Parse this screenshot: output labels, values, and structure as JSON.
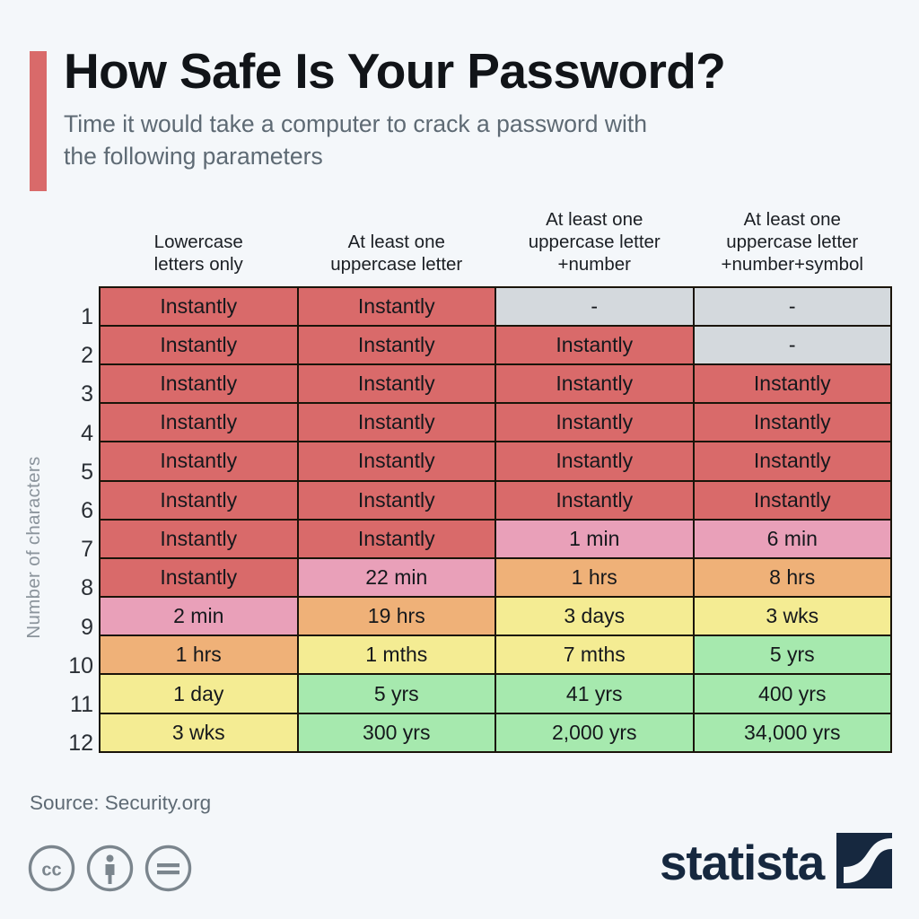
{
  "header": {
    "title": "How Safe Is Your Password?",
    "subtitle": "Time it would take a computer to crack a password with the following parameters",
    "accent_color": "#d96a6a"
  },
  "axis": {
    "y_title": "Number of characters"
  },
  "footer": {
    "source": "Source: Security.org",
    "brand": "statista",
    "cc_icons": [
      "creative-commons-icon",
      "attribution-icon",
      "no-derivatives-icon"
    ]
  },
  "legend_colors": {
    "instant_red": "#d96a6a",
    "minutes_pink": "#e9a0b9",
    "hours_orange": "#efb178",
    "days_months_yellow": "#f4ec93",
    "years_green": "#a6e9ae",
    "not_applicable_gray": "#d4d9dd"
  },
  "chart_data": {
    "type": "heatmap",
    "title": "How Safe Is Your Password?",
    "subtitle": "Time it would take a computer to crack a password with the following parameters",
    "xlabel": "",
    "ylabel": "Number of characters",
    "source": "Source: Security.org",
    "grid": true,
    "legend": "none",
    "categories": [
      "Lowercase letters only",
      "At least one uppercase letter",
      "At least one uppercase letter +number",
      "At least one uppercase letter +number+symbol"
    ],
    "column_headers": [
      [
        "Lowercase",
        "letters only"
      ],
      [
        "At least one",
        "uppercase letter"
      ],
      [
        "At least one",
        "uppercase letter",
        "+number"
      ],
      [
        "At least one",
        "uppercase letter",
        "+number+symbol"
      ]
    ],
    "row_labels": [
      "1",
      "2",
      "3",
      "4",
      "5",
      "6",
      "7",
      "8",
      "9",
      "10",
      "11",
      "12"
    ],
    "rows": [
      {
        "n": "1",
        "cells": [
          {
            "text": "Instantly",
            "color": "#d96a6a",
            "level": "instant"
          },
          {
            "text": "Instantly",
            "color": "#d96a6a",
            "level": "instant"
          },
          {
            "text": "-",
            "color": "#d4d9dd",
            "level": "na"
          },
          {
            "text": "-",
            "color": "#d4d9dd",
            "level": "na"
          }
        ]
      },
      {
        "n": "2",
        "cells": [
          {
            "text": "Instantly",
            "color": "#d96a6a",
            "level": "instant"
          },
          {
            "text": "Instantly",
            "color": "#d96a6a",
            "level": "instant"
          },
          {
            "text": "Instantly",
            "color": "#d96a6a",
            "level": "instant"
          },
          {
            "text": "-",
            "color": "#d4d9dd",
            "level": "na"
          }
        ]
      },
      {
        "n": "3",
        "cells": [
          {
            "text": "Instantly",
            "color": "#d96a6a",
            "level": "instant"
          },
          {
            "text": "Instantly",
            "color": "#d96a6a",
            "level": "instant"
          },
          {
            "text": "Instantly",
            "color": "#d96a6a",
            "level": "instant"
          },
          {
            "text": "Instantly",
            "color": "#d96a6a",
            "level": "instant"
          }
        ]
      },
      {
        "n": "4",
        "cells": [
          {
            "text": "Instantly",
            "color": "#d96a6a",
            "level": "instant"
          },
          {
            "text": "Instantly",
            "color": "#d96a6a",
            "level": "instant"
          },
          {
            "text": "Instantly",
            "color": "#d96a6a",
            "level": "instant"
          },
          {
            "text": "Instantly",
            "color": "#d96a6a",
            "level": "instant"
          }
        ]
      },
      {
        "n": "5",
        "cells": [
          {
            "text": "Instantly",
            "color": "#d96a6a",
            "level": "instant"
          },
          {
            "text": "Instantly",
            "color": "#d96a6a",
            "level": "instant"
          },
          {
            "text": "Instantly",
            "color": "#d96a6a",
            "level": "instant"
          },
          {
            "text": "Instantly",
            "color": "#d96a6a",
            "level": "instant"
          }
        ]
      },
      {
        "n": "6",
        "cells": [
          {
            "text": "Instantly",
            "color": "#d96a6a",
            "level": "instant"
          },
          {
            "text": "Instantly",
            "color": "#d96a6a",
            "level": "instant"
          },
          {
            "text": "Instantly",
            "color": "#d96a6a",
            "level": "instant"
          },
          {
            "text": "Instantly",
            "color": "#d96a6a",
            "level": "instant"
          }
        ]
      },
      {
        "n": "7",
        "cells": [
          {
            "text": "Instantly",
            "color": "#d96a6a",
            "level": "instant"
          },
          {
            "text": "Instantly",
            "color": "#d96a6a",
            "level": "instant"
          },
          {
            "text": "1 min",
            "color": "#e9a0b9",
            "level": "minutes"
          },
          {
            "text": "6 min",
            "color": "#e9a0b9",
            "level": "minutes"
          }
        ]
      },
      {
        "n": "8",
        "cells": [
          {
            "text": "Instantly",
            "color": "#d96a6a",
            "level": "instant"
          },
          {
            "text": "22 min",
            "color": "#e9a0b9",
            "level": "minutes"
          },
          {
            "text": "1 hrs",
            "color": "#efb178",
            "level": "hours"
          },
          {
            "text": "8 hrs",
            "color": "#efb178",
            "level": "hours"
          }
        ]
      },
      {
        "n": "9",
        "cells": [
          {
            "text": "2 min",
            "color": "#e9a0b9",
            "level": "minutes"
          },
          {
            "text": "19 hrs",
            "color": "#efb178",
            "level": "hours"
          },
          {
            "text": "3 days",
            "color": "#f4ec93",
            "level": "days"
          },
          {
            "text": "3 wks",
            "color": "#f4ec93",
            "level": "days"
          }
        ]
      },
      {
        "n": "10",
        "cells": [
          {
            "text": "1 hrs",
            "color": "#efb178",
            "level": "hours"
          },
          {
            "text": "1 mths",
            "color": "#f4ec93",
            "level": "days"
          },
          {
            "text": "7 mths",
            "color": "#f4ec93",
            "level": "days"
          },
          {
            "text": "5 yrs",
            "color": "#a6e9ae",
            "level": "years"
          }
        ]
      },
      {
        "n": "11",
        "cells": [
          {
            "text": "1 day",
            "color": "#f4ec93",
            "level": "days"
          },
          {
            "text": "5 yrs",
            "color": "#a6e9ae",
            "level": "years"
          },
          {
            "text": "41 yrs",
            "color": "#a6e9ae",
            "level": "years"
          },
          {
            "text": "400 yrs",
            "color": "#a6e9ae",
            "level": "years"
          }
        ]
      },
      {
        "n": "12",
        "cells": [
          {
            "text": "3 wks",
            "color": "#f4ec93",
            "level": "days"
          },
          {
            "text": "300 yrs",
            "color": "#a6e9ae",
            "level": "years"
          },
          {
            "text": "2,000 yrs",
            "color": "#a6e9ae",
            "level": "years"
          },
          {
            "text": "34,000 yrs",
            "color": "#a6e9ae",
            "level": "years"
          }
        ]
      }
    ]
  }
}
